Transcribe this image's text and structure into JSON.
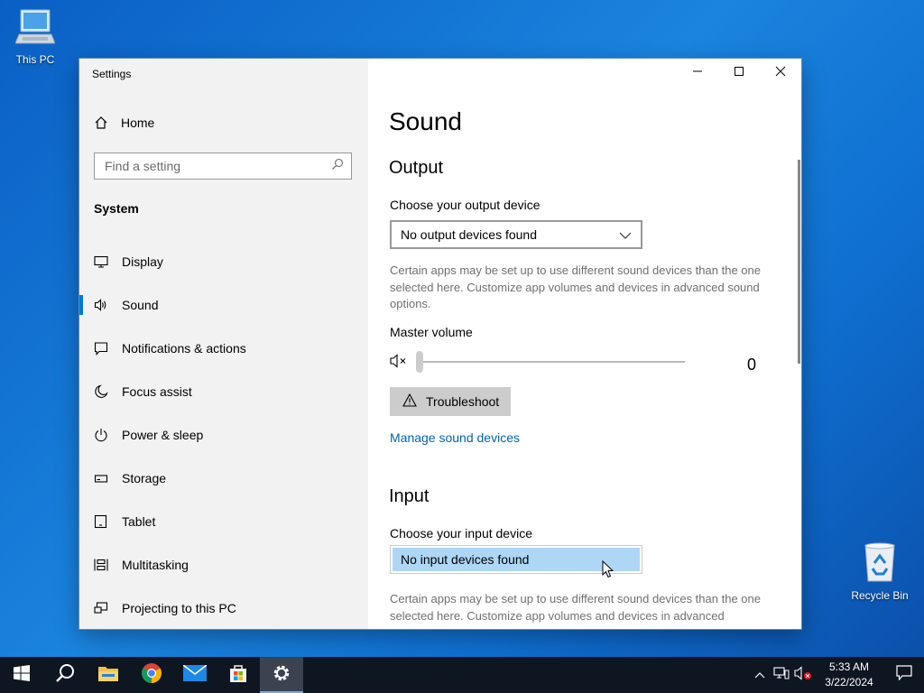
{
  "desktop": {
    "this_pc_label": "This PC",
    "recycle_bin_label": "Recycle Bin"
  },
  "window": {
    "title": "Settings",
    "controls": [
      "minimize-icon",
      "maximize-icon",
      "close-icon"
    ]
  },
  "sidebar": {
    "home_label": "Home",
    "search_placeholder": "Find a setting",
    "section_title": "System",
    "items": [
      {
        "label": "Display",
        "icon": "display-icon"
      },
      {
        "label": "Sound",
        "icon": "speaker-icon",
        "active": true
      },
      {
        "label": "Notifications & actions",
        "icon": "notification-icon"
      },
      {
        "label": "Focus assist",
        "icon": "moon-icon"
      },
      {
        "label": "Power & sleep",
        "icon": "power-icon"
      },
      {
        "label": "Storage",
        "icon": "storage-icon"
      },
      {
        "label": "Tablet",
        "icon": "tablet-icon"
      },
      {
        "label": "Multitasking",
        "icon": "multitasking-icon"
      },
      {
        "label": "Projecting to this PC",
        "icon": "projecting-icon"
      }
    ]
  },
  "main": {
    "title": "Sound",
    "output": {
      "heading": "Output",
      "device_label": "Choose your output device",
      "device_value": "No output devices found",
      "description": "Certain apps may be set up to use different sound devices than the one selected here. Customize app volumes and devices in advanced sound options.",
      "volume_label": "Master volume",
      "volume_value": "0",
      "volume_level": 0,
      "troubleshoot_label": "Troubleshoot",
      "manage_link": "Manage sound devices"
    },
    "input": {
      "heading": "Input",
      "device_label": "Choose your input device",
      "device_value": "No input devices found",
      "description": "Certain apps may be set up to use different sound devices than the one selected here. Customize app volumes and devices in advanced"
    }
  },
  "taskbar": {
    "apps": [
      "start-icon",
      "search-icon",
      "file-explorer-icon",
      "chrome-icon",
      "mail-icon",
      "store-icon",
      "settings-icon"
    ],
    "active_app": "settings-icon",
    "time": "5:33 AM",
    "date": "3/22/2024"
  },
  "colors": {
    "accent": "#0078d7",
    "link": "#0063b1",
    "selected_item": "#aed6f5",
    "taskbar": "#0e1621"
  }
}
